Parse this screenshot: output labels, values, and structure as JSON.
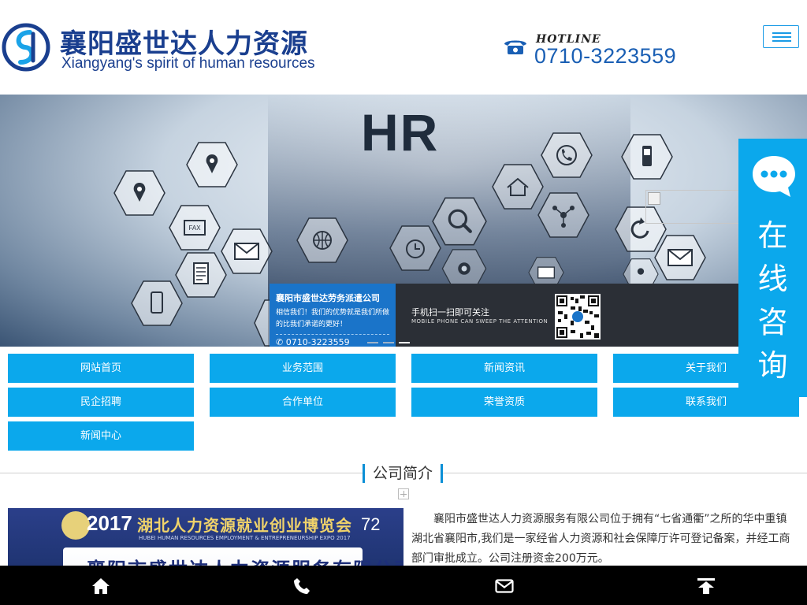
{
  "header": {
    "logo_cn": "襄阳盛世达人力资源",
    "logo_en": "Xiangyang's spirit of human resources",
    "hotline_label": "HOTLINE",
    "hotline_number": "0710-3223559"
  },
  "banner": {
    "hr_text": "HR",
    "card_title": "襄阳市盛世达劳务派遣公司",
    "card_text": "相信我们！我们的优势就是我们所做的比我们承诺的更好！",
    "card_phone": "0710-3223559",
    "qr_title": "手机扫一扫即可关注",
    "qr_subtitle": "MOBILE PHONE CAN SWEEP THE ATTENTION",
    "fax_label": "FAX"
  },
  "nav": {
    "items": [
      "网站首页",
      "业务范围",
      "新闻资讯",
      "关于我们",
      "民企招聘",
      "合作单位",
      "荣誉资质",
      "联系我们",
      "新闻中心"
    ]
  },
  "consult": {
    "label": "在线咨询",
    "chars": [
      "在",
      "线",
      "咨",
      "询"
    ]
  },
  "about": {
    "title": "公司简介",
    "image_year": "2017",
    "image_title": "湖北人力资源就业创业博览会",
    "image_subtitle": "HUBEI HUMAN RESOURCES EMPLOYMENT & ENTREPRENEURSHIP EXPO 2017",
    "image_number": "72",
    "image_board": "襄阳市盛世达人力资源服务有限公司",
    "text": "襄阳市盛世达人力资源服务有限公司位于拥有“七省通衢”之所的华中重镇湖北省襄阳市,我们是一家经省人力资源和社会保障厅许可登记备案，并经工商部门审批成立。公司注册资金200万元。"
  },
  "bottombar": {
    "icons": [
      "home-icon",
      "phone-icon",
      "mail-icon",
      "back-to-top-icon"
    ]
  },
  "colors": {
    "accent": "#0ba8ec",
    "brand": "#1a3f8f",
    "bottom_bar": "#000000",
    "banner_card": "#1a74c9"
  }
}
